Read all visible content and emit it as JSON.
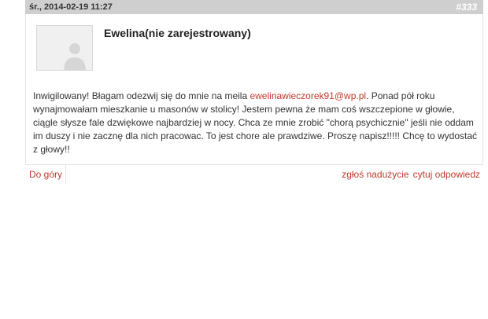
{
  "post": {
    "date": "śr., 2014-02-19 11:27",
    "number": "#333",
    "author": "Ewelina(nie zarejestrowany)",
    "text_before_email": "Inwigilowany! Błagam odezwij się do mnie na meila ",
    "email": "ewelinawieczorek91@wp.pl",
    "text_after_email": ". Ponad pół roku wynajmowałam mieszkanie u masonów w stolicy! Jestem pewna że mam coś wszczepione w głowie, ciągle słysze fale dzwiękowe najbardziej w nocy. Chca ze mnie zrobić \"chorą psychicznie\" jeśli nie oddam im duszy i nie zacznę dla nich pracowac. To jest chore ale prawdziwe. Proszę napisz!!!!! Chcę to wydostać z głowy!!"
  },
  "footer": {
    "back_to_top": "Do góry",
    "report": "zgłoś nadużycie",
    "quote": "cytuj odpowiedz"
  },
  "colors": {
    "link": "#c0392b",
    "header_bg": "#cfcfcf"
  },
  "icons": {
    "avatar": "default-user-avatar-icon"
  }
}
